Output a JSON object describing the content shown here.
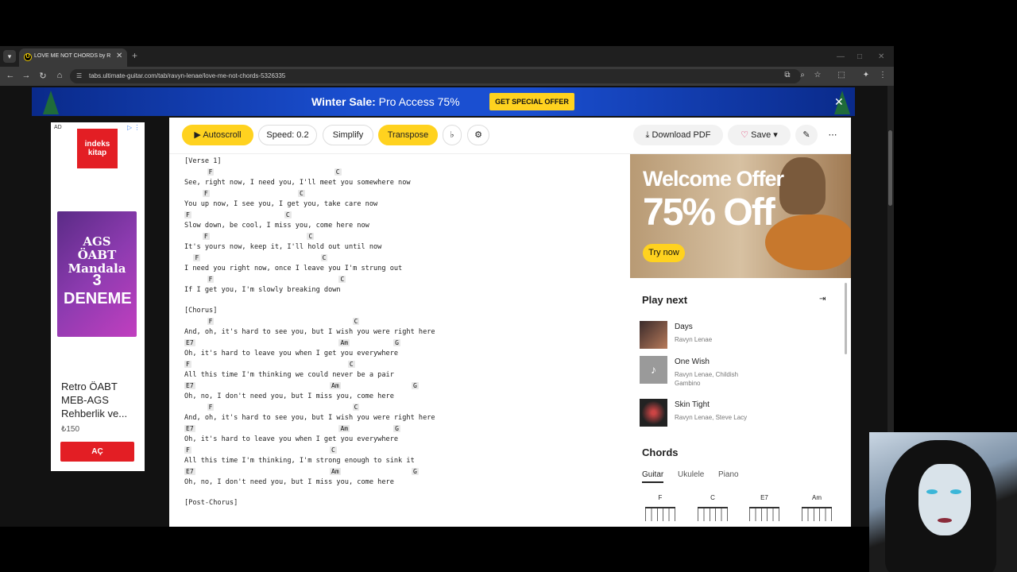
{
  "browser": {
    "tab_title": "LOVE ME NOT CHORDS by Ravyn",
    "url": "tabs.ultimate-guitar.com/tab/ravyn-lenae/love-me-not-chords-5326335"
  },
  "banner": {
    "text_bold": "Winter Sale:",
    "text_rest": " Pro Access 75%",
    "cta": "GET SPECIAL OFFER"
  },
  "ad": {
    "label": "AD",
    "logo": "indeks kitap",
    "book_title": "AGS ÖABT Mandala",
    "book_sub": "3 DENEME",
    "product": "Retro ÖABT MEB-AGS Rehberlik ve...",
    "price": "₺150",
    "button": "AÇ"
  },
  "toolbar": {
    "autoscroll": "Autoscroll",
    "speed": "Speed: 0.2",
    "simplify": "Simplify",
    "transpose": "Transpose",
    "download": "Download PDF",
    "save": "Save"
  },
  "tab_lines": [
    {
      "text": "[Verse 1]",
      "chords": []
    },
    {
      "text": "See, right now, I need you, I'll meet you somewhere now",
      "chords": [
        {
          "c": "F",
          "col": 5
        },
        {
          "c": "C",
          "col": 33
        }
      ]
    },
    {
      "text": "You up now, I see you, I get you, take care now",
      "chords": [
        {
          "c": "F",
          "col": 4
        },
        {
          "c": "C",
          "col": 25
        }
      ]
    },
    {
      "text": "Slow down, be cool, I miss you, come here now",
      "chords": [
        {
          "c": "F",
          "col": 0
        },
        {
          "c": "C",
          "col": 22
        }
      ]
    },
    {
      "text": "It's yours now, keep it, I'll hold out until now",
      "chords": [
        {
          "c": "F",
          "col": 4
        },
        {
          "c": "C",
          "col": 27
        }
      ]
    },
    {
      "text": "I need you right now, once I leave you I'm strung out",
      "chords": [
        {
          "c": "F",
          "col": 2
        },
        {
          "c": "C",
          "col": 30
        }
      ]
    },
    {
      "text": "If I get you, I'm slowly breaking down",
      "chords": [
        {
          "c": "F",
          "col": 5
        },
        {
          "c": "C",
          "col": 34
        }
      ]
    },
    {
      "text": "",
      "chords": []
    },
    {
      "text": "[Chorus]",
      "chords": []
    },
    {
      "text": "And, oh, it's hard to see you, but I wish you were right here",
      "chords": [
        {
          "c": "F",
          "col": 5
        },
        {
          "c": "C",
          "col": 37
        }
      ]
    },
    {
      "text": "Oh, it's hard to leave you when I get you everywhere",
      "chords": [
        {
          "c": "E7",
          "col": 0
        },
        {
          "c": "Am",
          "col": 34
        },
        {
          "c": "G",
          "col": 46
        }
      ]
    },
    {
      "text": "All this time I'm thinking we could never be a pair",
      "chords": [
        {
          "c": "F",
          "col": 0
        },
        {
          "c": "C",
          "col": 36
        }
      ]
    },
    {
      "text": "Oh, no, I don't need you, but I miss you, come here",
      "chords": [
        {
          "c": "E7",
          "col": 0
        },
        {
          "c": "Am",
          "col": 32
        },
        {
          "c": "G",
          "col": 50
        }
      ]
    },
    {
      "text": "And, oh, it's hard to see you, but I wish you were right here",
      "chords": [
        {
          "c": "F",
          "col": 5
        },
        {
          "c": "C",
          "col": 37
        }
      ]
    },
    {
      "text": "Oh, it's hard to leave you when I get you everywhere",
      "chords": [
        {
          "c": "E7",
          "col": 0
        },
        {
          "c": "Am",
          "col": 34
        },
        {
          "c": "G",
          "col": 46
        }
      ]
    },
    {
      "text": "All this time I'm thinking, I'm strong enough to sink it",
      "chords": [
        {
          "c": "F",
          "col": 0
        },
        {
          "c": "C",
          "col": 32
        }
      ]
    },
    {
      "text": "Oh, no, I don't need you, but I miss you, come here",
      "chords": [
        {
          "c": "E7",
          "col": 0
        },
        {
          "c": "Am",
          "col": 32
        },
        {
          "c": "G",
          "col": 50
        }
      ]
    },
    {
      "text": "",
      "chords": []
    },
    {
      "text": "[Post-Chorus]",
      "chords": []
    }
  ],
  "promo": {
    "headline": "Welcome Offer",
    "discount": "75% Off",
    "button": "Try now"
  },
  "play_next": {
    "title": "Play next",
    "songs": [
      {
        "title": "Days",
        "artist": "Ravyn Lenae"
      },
      {
        "title": "One Wish",
        "artist": "Ravyn Lenae, Childish Gambino"
      },
      {
        "title": "Skin Tight",
        "artist": "Ravyn Lenae, Steve Lacy"
      }
    ]
  },
  "chords_section": {
    "title": "Chords",
    "tabs": [
      "Guitar",
      "Ukulele",
      "Piano"
    ],
    "diagrams": [
      "F",
      "C",
      "E7",
      "Am"
    ]
  }
}
